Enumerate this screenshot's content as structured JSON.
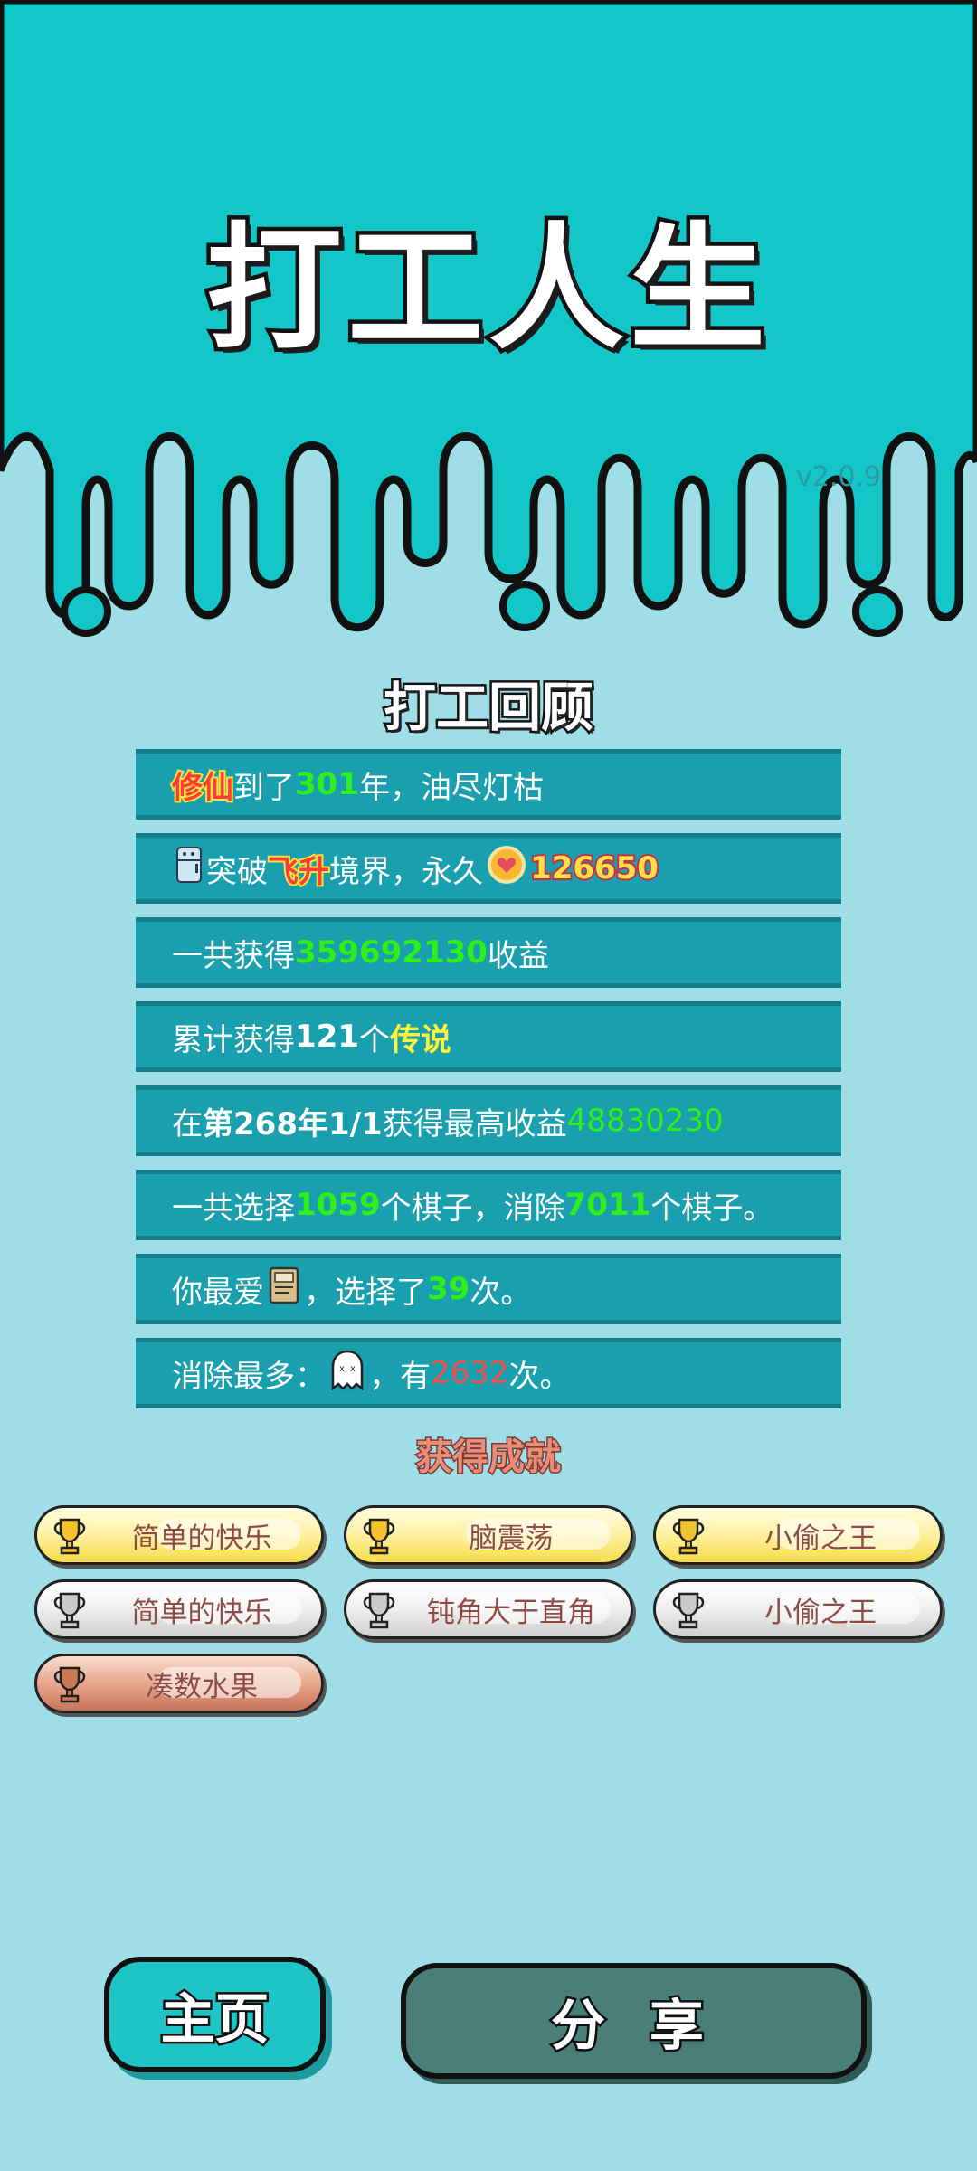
{
  "header": {
    "title": "打工人生",
    "version": "v2.0.9"
  },
  "review": {
    "title": "打工回顾",
    "rows": [
      {
        "a": "修仙",
        "b": "到了",
        "c": "301",
        "d": "年，油尽灯枯"
      },
      {
        "a": "突破",
        "b": "飞升",
        "c": "境界，永久",
        "d": "126650"
      },
      {
        "a": "一共获得",
        "b": "359692130",
        "c": "收益"
      },
      {
        "a": "累计获得",
        "b": "121",
        "c": "个",
        "d": "传说"
      },
      {
        "a": "在 ",
        "b": "第268年1/1",
        "c": " 获得最高收益",
        "d": "48830230"
      },
      {
        "a": "一共选择",
        "b": "1059",
        "c": "个棋子，消除",
        "d": "7011",
        "e": "个棋子。"
      },
      {
        "a": "你最爱",
        "b": "，选择了",
        "c": "39",
        "d": "次。"
      },
      {
        "a": "消除最多：",
        "b": "，有",
        "c": "2632",
        "d": "次。"
      }
    ]
  },
  "achievements": {
    "title": "获得成就",
    "items": [
      {
        "label": "简单的快乐",
        "tier": "gold"
      },
      {
        "label": "脑震荡",
        "tier": "gold"
      },
      {
        "label": "小偷之王",
        "tier": "gold"
      },
      {
        "label": "简单的快乐",
        "tier": "silver"
      },
      {
        "label": "钝角大于直角",
        "tier": "silver"
      },
      {
        "label": "小偷之王",
        "tier": "silver"
      },
      {
        "label": "凑数水果",
        "tier": "bronze"
      }
    ]
  },
  "buttons": {
    "home": "主页",
    "share": "分 享"
  },
  "icons": [
    "fridge-icon",
    "coin-heart-icon",
    "book-icon",
    "ghost-icon",
    "trophy-icon"
  ],
  "colors": {
    "sky": "#13c6c8",
    "background": "#9fdee6",
    "row": "#1a9fae",
    "highlight_green": "#2ef01a",
    "highlight_yellow": "#fff23a"
  }
}
